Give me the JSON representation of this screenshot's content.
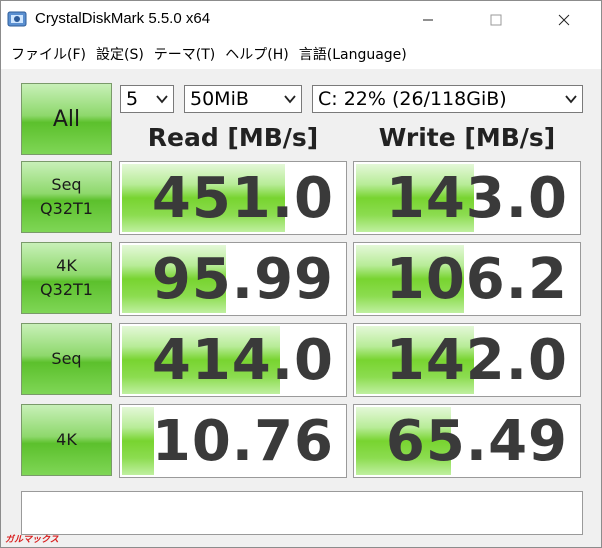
{
  "window": {
    "title": "CrystalDiskMark 5.5.0 x64"
  },
  "menu": [
    "ファイル(F)",
    "設定(S)",
    "テーマ(T)",
    "ヘルプ(H)",
    "言語(Language)"
  ],
  "controls": {
    "all_label": "All",
    "count": "5",
    "size": "50MiB",
    "drive": "C: 22% (26/118GiB)"
  },
  "headers": {
    "read": "Read [MB/s]",
    "write": "Write [MB/s]"
  },
  "rows": [
    {
      "label": "Seq\nQ32T1",
      "read": "451.0",
      "write": "143.0",
      "read_fill": 0.72,
      "write_fill": 0.52
    },
    {
      "label": "4K\nQ32T1",
      "read": "95.99",
      "write": "106.2",
      "read_fill": 0.46,
      "write_fill": 0.48
    },
    {
      "label": "Seq",
      "read": "414.0",
      "write": "142.0",
      "read_fill": 0.7,
      "write_fill": 0.52
    },
    {
      "label": "4K",
      "read": "10.76",
      "write": "65.49",
      "read_fill": 0.14,
      "write_fill": 0.42
    }
  ],
  "watermark": "ガルマックス",
  "colors": {
    "accent_green": "#78d430",
    "button_green": "#5cc02c",
    "value_text": "#3a3a3a",
    "watermark_red": "#d92020"
  }
}
